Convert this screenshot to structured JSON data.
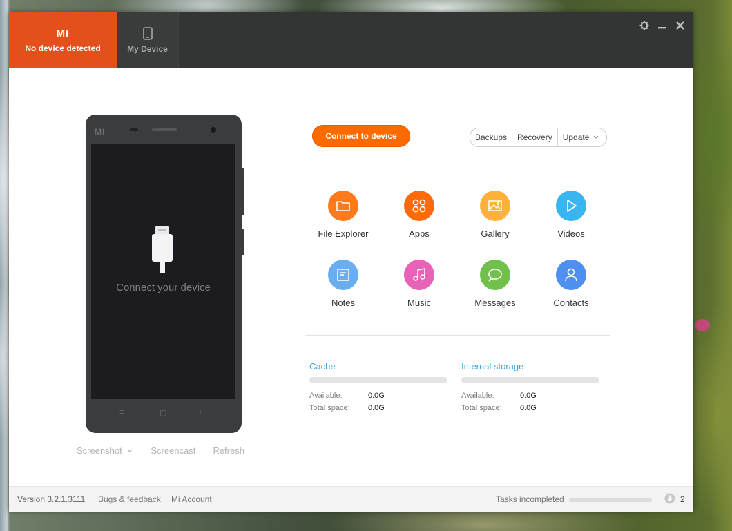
{
  "window": {
    "nav": {
      "active_tab_label": "No device detected",
      "active_tab_logo": "MI",
      "my_device_label": "My Device"
    },
    "controls": [
      "gear-icon",
      "minimize-icon",
      "close-icon"
    ]
  },
  "phone": {
    "brand": "MI",
    "screen_text": "Connect your device",
    "actions": {
      "screenshot": "Screenshot",
      "screencast": "Screencast",
      "refresh": "Refresh"
    }
  },
  "main": {
    "connect_button": "Connect to device",
    "segments": [
      "Backups",
      "Recovery",
      "Update"
    ],
    "apps": [
      {
        "label": "File Explorer",
        "icon": "folder-icon",
        "color": "#ff7a1a"
      },
      {
        "label": "Apps",
        "icon": "apps-icon",
        "color": "#ff6a0a"
      },
      {
        "label": "Gallery",
        "icon": "gallery-icon",
        "color": "#ffb13a"
      },
      {
        "label": "Videos",
        "icon": "play-icon",
        "color": "#39b5f0"
      },
      {
        "label": "Notes",
        "icon": "notes-icon",
        "color": "#6aaef2"
      },
      {
        "label": "Music",
        "icon": "music-icon",
        "color": "#e862b8"
      },
      {
        "label": "Messages",
        "icon": "message-icon",
        "color": "#72c04c"
      },
      {
        "label": "Contacts",
        "icon": "contact-icon",
        "color": "#4f8ff0"
      }
    ],
    "storage": [
      {
        "title": "Cache",
        "available_label": "Available:",
        "available": "0.0G",
        "total_label": "Total space:",
        "total": "0.0G",
        "fill": 0
      },
      {
        "title": "Internal storage",
        "available_label": "Available:",
        "available": "0.0G",
        "total_label": "Total space:",
        "total": "0.0G",
        "fill": 0
      }
    ]
  },
  "footer": {
    "version": "Version 3.2.1.3111",
    "bugs_link": "Bugs & feedback",
    "account_link": "Mi Account",
    "tasks_label": "Tasks incompleted",
    "tasks_progress": 0,
    "tasks_count": "2"
  },
  "colors": {
    "accent": "#e3501b",
    "button": "#ff6a00",
    "link_blue": "#39a6df"
  }
}
